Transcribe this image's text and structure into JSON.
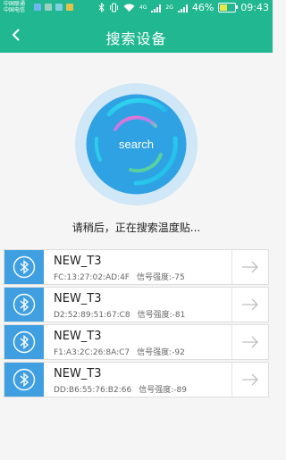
{
  "status_bar": {
    "carrier_1": "中国联通",
    "carrier_2": "中国电信",
    "battery": "46%",
    "time": "09:43",
    "network_1": "4G",
    "network_2": "2G"
  },
  "header": {
    "title": "搜索设备"
  },
  "scan": {
    "button_label": "search",
    "status": "请稍后，正在搜索温度贴..."
  },
  "devices": [
    {
      "name": "NEW_T3",
      "mac": "FC:13:27:02:AD:4F",
      "signal": "信号强度:-75"
    },
    {
      "name": "NEW_T3",
      "mac": "D2:52:89:51:67:C8",
      "signal": "信号强度:-81"
    },
    {
      "name": "NEW_T3",
      "mac": "F1:A3:2C:26:8A:C7",
      "signal": "信号强度:-92"
    },
    {
      "name": "NEW_T3",
      "mac": "DD:B6:55:76:B2:66",
      "signal": "信号强度:-89"
    }
  ],
  "colors": {
    "accent": "#21b891",
    "bluetooth_tile": "#3f9fe0",
    "radar_outer": "#cfe7f7",
    "radar_inner": "#2fa2e3"
  }
}
